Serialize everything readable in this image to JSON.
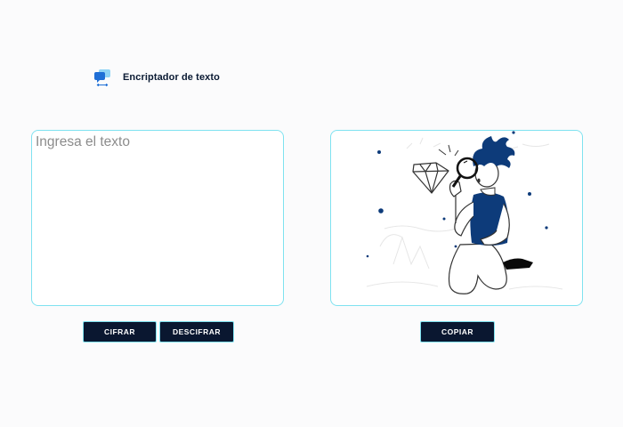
{
  "header": {
    "title": "Encriptador de texto",
    "logo_icon": "chat-bubbles-icon"
  },
  "input": {
    "placeholder": "Ingresa el texto",
    "value": ""
  },
  "output": {
    "illustration": "person-with-magnifying-glass-and-diamond"
  },
  "buttons": {
    "encrypt_label": "CIFRAR",
    "decrypt_label": "DESCIFRAR",
    "copy_label": "COPIAR"
  },
  "colors": {
    "accent_border": "#7fe2f0",
    "button_bg": "#0a1730",
    "illustration_blue": "#0d3b7a"
  }
}
